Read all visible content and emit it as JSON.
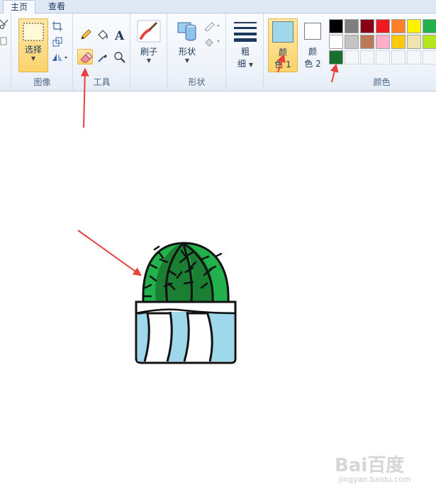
{
  "tabs": [
    {
      "label": "主页",
      "active": true
    },
    {
      "label": "查看",
      "active": false
    }
  ],
  "groups": {
    "image": {
      "label": "图像",
      "select_label": "选择"
    },
    "tools": {
      "label": "工具"
    },
    "brush": {
      "label": "刷子"
    },
    "shapes": {
      "label": "形状",
      "shapes_label": "形状"
    },
    "size": {
      "line1": "粗",
      "line2": "细"
    },
    "color1": {
      "line1": "颜",
      "line2": "色 1",
      "swatch": "#9dd9ea"
    },
    "color2": {
      "line1": "颜",
      "line2": "色 2",
      "swatch": "#ffffff"
    },
    "colors": {
      "label": "颜色"
    }
  },
  "palette_row1": [
    "#000000",
    "#7f7f7f",
    "#880015",
    "#ed1c24",
    "#ff7f27",
    "#fff200",
    "#22b14c"
  ],
  "palette_row2": [
    "#ffffff",
    "#c3c3c3",
    "#b97a57",
    "#ffaec9",
    "#ffc90e",
    "#efe4b0",
    "#b5e61d"
  ],
  "palette_row3": [
    "#1a6e2f"
  ],
  "watermark": {
    "text": "Bai百度",
    "url": "jingyan.baidu.com"
  },
  "accent_arrow_color": "#e8403a"
}
